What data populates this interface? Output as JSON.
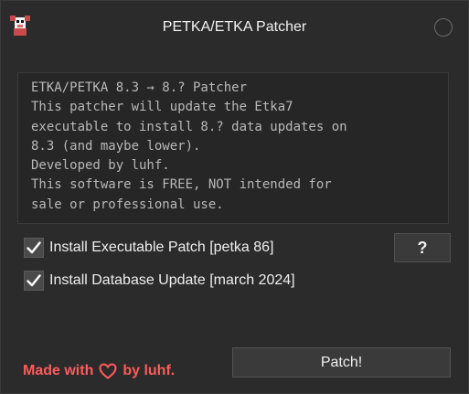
{
  "window": {
    "title": "PETKA/ETKA Patcher",
    "icon": "cartoon-character-icon"
  },
  "info": {
    "text": "ETKA/PETKA 8.3 → 8.? Patcher\nThis patcher will update the Etka7\nexecutable to install 8.? data updates on\n8.3 (and maybe lower).\nDeveloped by luhf.\nThis software is FREE, NOT intended for\nsale or professional use."
  },
  "options": {
    "executable_patch": {
      "label": "Install Executable Patch [petka 86]",
      "checked": true
    },
    "database_update": {
      "label": "Install Database Update [march 2024]",
      "checked": true
    }
  },
  "help_button": {
    "label": "?"
  },
  "footer": {
    "made_with_prefix": "Made with",
    "made_with_suffix": "by luhf.",
    "accent_color": "#ff5b5b"
  },
  "patch_button": {
    "label": "Patch!"
  }
}
